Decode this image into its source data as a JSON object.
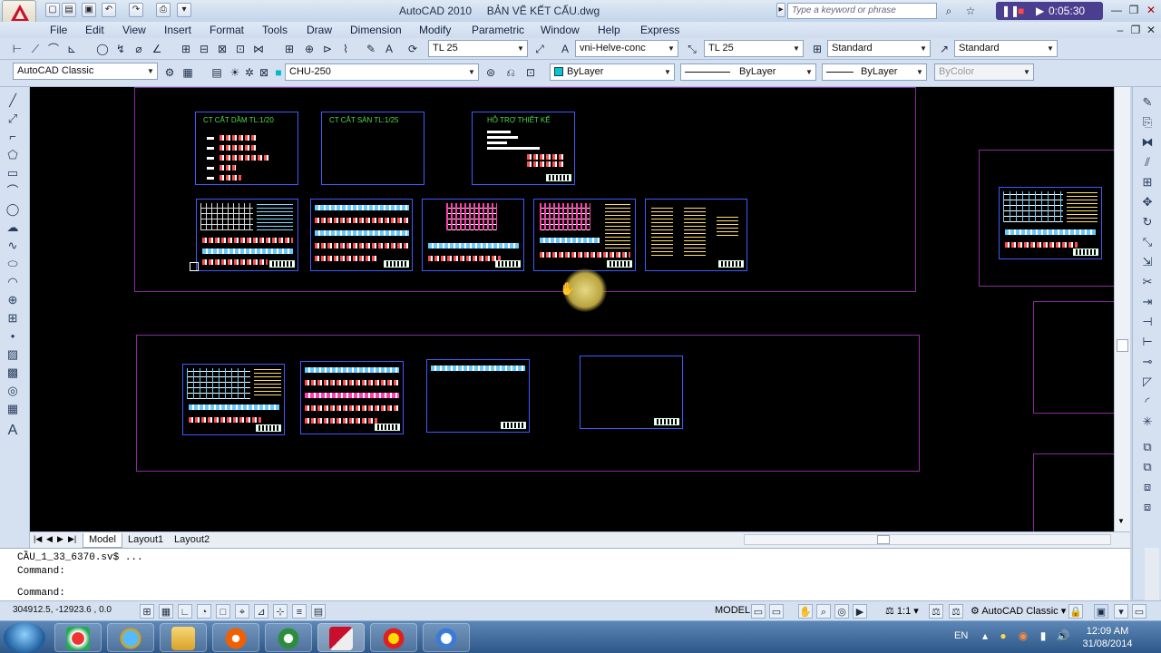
{
  "titlebar": {
    "app_name": "AutoCAD 2010",
    "file_name": "BẢN VẼ KẾT CẤU.dwg",
    "search_placeholder": "Type a keyword or phrase",
    "recording_time": "0:05:30"
  },
  "menu": [
    "File",
    "Edit",
    "View",
    "Insert",
    "Format",
    "Tools",
    "Draw",
    "Dimension",
    "Modify",
    "Parametric",
    "Window",
    "Help",
    "Express"
  ],
  "toolbar1": {
    "dimscale": "TL 25",
    "text_style_font": "vni-Helve-conc",
    "dim_style": "TL 25",
    "table_style": "Standard",
    "multileader_style": "Standard"
  },
  "toolbar2": {
    "workspace": "AutoCAD Classic",
    "layer": "CHU-250",
    "color": "ByLayer",
    "linetype": "ByLayer",
    "lineweight": "ByLayer",
    "plot_style": "ByColor"
  },
  "drawing": {
    "sheet_titles": [
      "CT CẮT DẦM TL:1/20",
      "CT CẮT SÀN TL:1/25",
      "HỖ TRỢ THIẾT KẾ"
    ]
  },
  "tabs": [
    "Model",
    "Layout1",
    "Layout2"
  ],
  "command": {
    "line1": "CẦU_1_33_6370.sv$ ...",
    "line2": "Command:",
    "prompt": "Command:"
  },
  "status": {
    "coords": "304912.5, -12923.6 , 0.0",
    "space": "MODEL",
    "annotation_scale": "1:1",
    "workspace": "AutoCAD Classic"
  },
  "taskbar": {
    "language": "EN",
    "time": "12:09 AM",
    "date": "31/08/2014"
  },
  "colors": {
    "canvas": "#000000",
    "frame": "#8a2b9c",
    "sheet_border": "#3d5cff",
    "title_text": "#4fdc4f"
  }
}
